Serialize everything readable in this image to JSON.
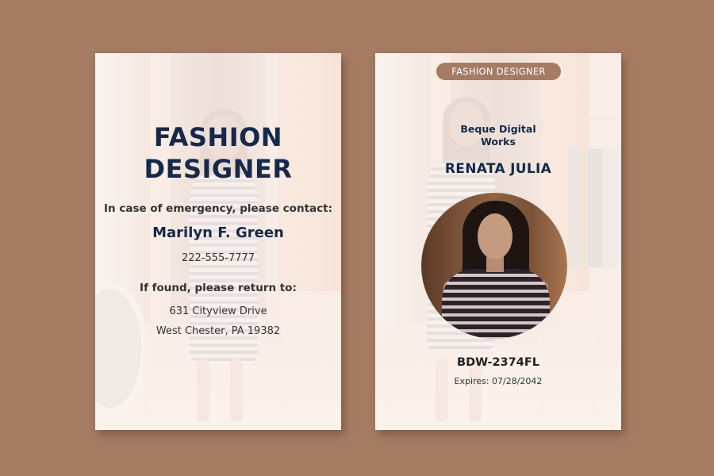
{
  "back": {
    "title_line1": "FASHION",
    "title_line2": "DESIGNER",
    "emergency_label": "In case of emergency, please contact:",
    "contact_name": "Marilyn F. Green",
    "contact_phone": "222-555-7777",
    "return_label": "If found, please return to:",
    "address_line1": "631 Cityview Drive",
    "address_line2": "West Chester, PA 19382"
  },
  "front": {
    "role_badge": "FASHION DESIGNER",
    "company_line1": "Beque Digital",
    "company_line2": "Works",
    "person_name": "RENATA JULIA",
    "id_code": "BDW-2374FL",
    "expires": "Expires: 07/28/2042"
  },
  "colors": {
    "background": "#a57c63",
    "navy": "#16294a",
    "badge": "#a57c63"
  },
  "icons": {
    "photo": "portrait-photo"
  }
}
